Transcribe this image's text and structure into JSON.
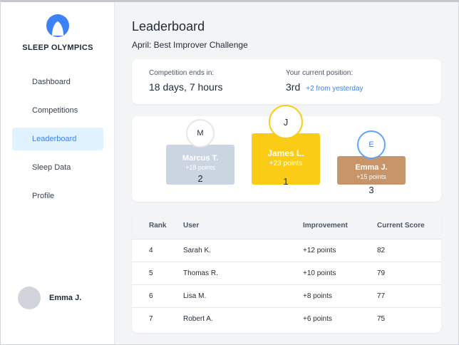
{
  "brand": {
    "name": "SLEEP OLYMPICS",
    "accent": "#3b82f6"
  },
  "sidebar": {
    "items": [
      {
        "label": "Dashboard",
        "active": false
      },
      {
        "label": "Competitions",
        "active": false
      },
      {
        "label": "Leaderboard",
        "active": true
      },
      {
        "label": "Sleep Data",
        "active": false
      },
      {
        "label": "Profile",
        "active": false
      }
    ],
    "user": {
      "name": "Emma J."
    }
  },
  "header": {
    "title": "Leaderboard",
    "subtitle": "April: Best Improver Challenge"
  },
  "info": {
    "ends_label": "Competition ends in:",
    "ends_value": "18 days, 7 hours",
    "position_label": "Your current position:",
    "position_value": "3rd",
    "position_delta": "+2 from yesterday"
  },
  "podium": {
    "first": {
      "initial": "J",
      "name": "James L.",
      "points": "+23 points",
      "rank": "1",
      "color": "#facc15"
    },
    "second": {
      "initial": "M",
      "name": "Marcus T.",
      "points": "+18 points",
      "rank": "2",
      "color": "#cbd5e1"
    },
    "third": {
      "initial": "E",
      "name": "Emma J.",
      "points": "+15 points",
      "rank": "3",
      "color": "#c8956a"
    }
  },
  "table": {
    "headers": [
      "Rank",
      "User",
      "Improvement",
      "Current Score"
    ],
    "rows": [
      {
        "rank": "4",
        "user": "Sarah K.",
        "improvement": "+12 points",
        "score": "82"
      },
      {
        "rank": "5",
        "user": "Thomas R.",
        "improvement": "+10 points",
        "score": "79"
      },
      {
        "rank": "6",
        "user": "Lisa M.",
        "improvement": "+8 points",
        "score": "77"
      },
      {
        "rank": "7",
        "user": "Robert A.",
        "improvement": "+6 points",
        "score": "75"
      }
    ]
  }
}
